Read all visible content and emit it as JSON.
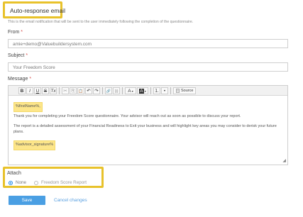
{
  "section": {
    "title": "Auto-response email",
    "description": "This is the email notification that will be sent to the user immediately following the completion of the questionnaire."
  },
  "from": {
    "label": "From",
    "required_mark": "*",
    "value": "amie+demo@Valuebuildersystem.com"
  },
  "subject": {
    "label": "Subject",
    "required_mark": "*",
    "value": "Your Freedom Score"
  },
  "message": {
    "label": "Message",
    "required_mark": "*",
    "toolbar": {
      "bold": "B",
      "italic": "I",
      "underline": "U",
      "strike": "S",
      "clear": "Tx",
      "cut": "✂",
      "copy": "⎘",
      "paste": "📋",
      "undo": "↶",
      "redo": "↷",
      "link": "🔗",
      "unlink": "⛓",
      "text_color": "A",
      "bg_color": "A",
      "numbered": "⒈",
      "bulleted": "•",
      "source": "Source"
    },
    "firstname_tag": "%firstName%,",
    "para1": "Thank you for completing your Freedom Score questionnaire. Your advisor will reach out as soon as possible to discuss your report.",
    "para2": "The report is a detailed assessment of your Financial Readiness to Exit your business and will highlight key areas you may consider to derisk your future plans.",
    "signature_tag": "%advisor_signature%"
  },
  "attach": {
    "label": "Attach",
    "options": [
      {
        "label": "None",
        "selected": true
      },
      {
        "label": "Freedom Score Report",
        "selected": false
      }
    ]
  },
  "actions": {
    "save": "Save",
    "cancel": "Cancel changes"
  }
}
